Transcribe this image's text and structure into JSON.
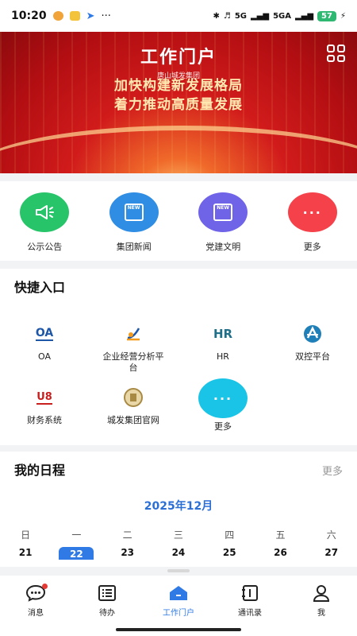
{
  "status_bar": {
    "time": "10:20",
    "left_glyphs": "···",
    "network": "5G",
    "network2": "5GA",
    "battery": "57"
  },
  "banner": {
    "title": "工作门户",
    "subtitle": "唐山城发集团",
    "slogan_line1": "加快构建新发展格局",
    "slogan_line2": "着力推动高质量发展"
  },
  "categories": [
    {
      "label": "公示公告",
      "color": "#27c46a",
      "icon": "megaphone-icon"
    },
    {
      "label": "集团新闻",
      "color": "#2f8de4",
      "icon": "news-icon",
      "badge": "NEW"
    },
    {
      "label": "党建文明",
      "color": "#6f63e8",
      "icon": "news-icon",
      "badge": "NEW"
    },
    {
      "label": "更多",
      "color": "#f5424a",
      "icon": "more-icon",
      "dots": "···"
    }
  ],
  "quick_entry": {
    "title": "快捷入口",
    "items": [
      {
        "label": "OA",
        "logo": "OA"
      },
      {
        "label": "企业经营分析平台",
        "logo": ""
      },
      {
        "label": "HR",
        "logo": "HR"
      },
      {
        "label": "双控平台",
        "logo": ""
      },
      {
        "label": "财务系统",
        "logo": "U8"
      },
      {
        "label": "城发集团官网",
        "logo": ""
      },
      {
        "label": "更多",
        "logo": "···"
      }
    ]
  },
  "schedule": {
    "title": "我的日程",
    "more": "更多",
    "month": "2025年12月",
    "weekdays": [
      "日",
      "一",
      "二",
      "三",
      "四",
      "五",
      "六"
    ],
    "days": [
      "21",
      "22",
      "23",
      "24",
      "25",
      "26",
      "27"
    ],
    "today_index": 1
  },
  "bottom_nav": [
    {
      "label": "消息",
      "icon": "chat-icon"
    },
    {
      "label": "待办",
      "icon": "list-icon"
    },
    {
      "label": "工作门户",
      "icon": "home-icon",
      "active": true
    },
    {
      "label": "通讯录",
      "icon": "contacts-icon"
    },
    {
      "label": "我",
      "icon": "user-icon"
    }
  ],
  "colors": {
    "accent": "#2f7ae5",
    "banner_red": "#c8161b"
  }
}
